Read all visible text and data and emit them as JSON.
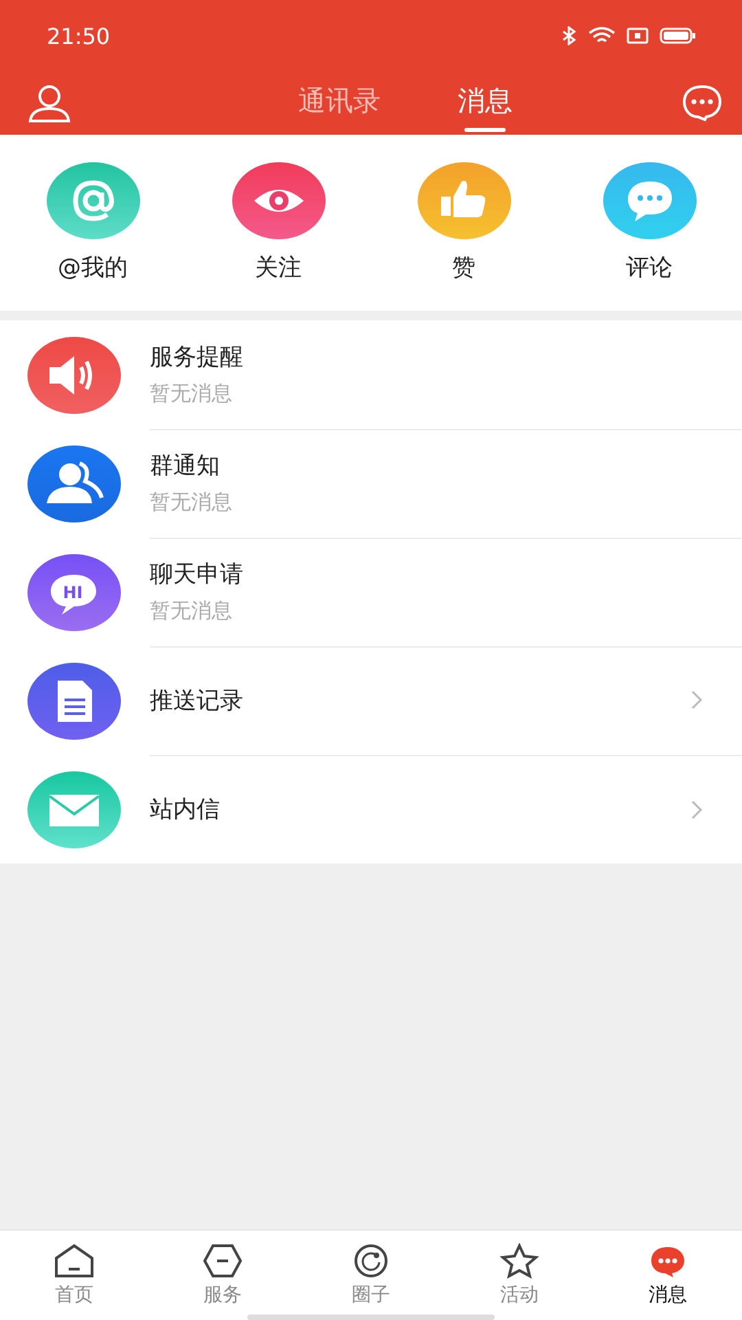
{
  "status_bar": {
    "time": "21:50"
  },
  "header": {
    "tabs": [
      {
        "label": "通讯录",
        "selected": false
      },
      {
        "label": "消息",
        "selected": true
      }
    ]
  },
  "quick_actions": [
    {
      "label": "@我的"
    },
    {
      "label": "关注"
    },
    {
      "label": "赞"
    },
    {
      "label": "评论"
    }
  ],
  "list": [
    {
      "title": "服务提醒",
      "subtitle": "暂无消息",
      "kind": "message"
    },
    {
      "title": "群通知",
      "subtitle": "暂无消息",
      "kind": "message"
    },
    {
      "title": "聊天申请",
      "subtitle": "暂无消息",
      "icon_text": "HI",
      "kind": "message"
    },
    {
      "title": "推送记录",
      "kind": "link"
    },
    {
      "title": "站内信",
      "kind": "link"
    }
  ],
  "bottom_nav": [
    {
      "label": "首页",
      "selected": false
    },
    {
      "label": "服务",
      "selected": false
    },
    {
      "label": "圈子",
      "selected": false
    },
    {
      "label": "活动",
      "selected": false
    },
    {
      "label": "消息",
      "selected": true
    }
  ]
}
